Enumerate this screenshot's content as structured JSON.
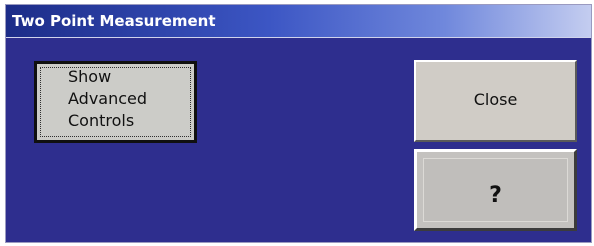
{
  "window": {
    "title": "Two Point Measurement"
  },
  "buttons": {
    "show_advanced_controls": {
      "lines": [
        "Show",
        "Advanced",
        "Controls"
      ]
    },
    "close": {
      "label": "Close"
    },
    "help": {
      "label": "?"
    }
  },
  "colors": {
    "window_background": "#2e2e8e",
    "titlebar_start": "#1c2c88",
    "titlebar_end": "#c4cdf0",
    "button_face": "#d0ccc6"
  }
}
